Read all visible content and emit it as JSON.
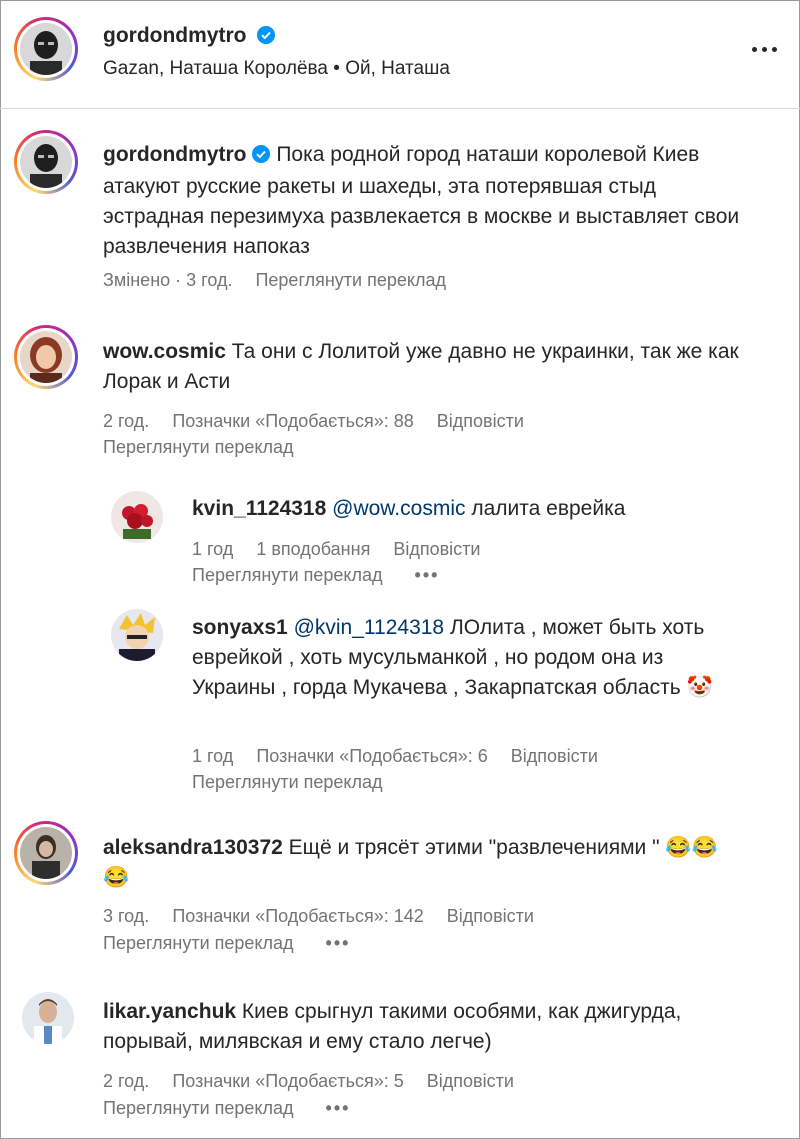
{
  "post": {
    "username": "gordondmytro",
    "audio": "Gazan, Наташа Королёва • Ой, Наташа"
  },
  "caption": {
    "username": "gordondmytro",
    "text": "Пока родной город наташи королевой Киев атакуют русские ракеты и шахеды, эта потерявшая стыд эстрадная перезимуха развлекается в москве и выставляет свои развлечения напоказ",
    "edited": "Змінено · 3 год.",
    "translate": "Переглянути переклад"
  },
  "comments": [
    {
      "username": "wow.cosmic",
      "text": "Та они с Лолитой уже давно не украинки, так же как Лорак и Асти",
      "time": "2 год.",
      "likes": "Позначки «Подобається»: 88",
      "reply": "Відповісти",
      "translate": "Переглянути переклад",
      "replies": [
        {
          "username": "kvin_1124318",
          "mention": "@wow.cosmic",
          "text": "лалита еврейка",
          "time": "1 год",
          "likes": "1 вподобання",
          "reply": "Відповісти",
          "translate": "Переглянути переклад",
          "more": "•••"
        },
        {
          "username": "sonyaxs1",
          "mention": "@kvin_1124318",
          "text": "ЛОлита , может быть хоть еврейкой , хоть мусульманкой , но родом она из Украины , горда Мукачева , Закарпатская область 🤡",
          "time": "1 год",
          "likes": "Позначки «Подобається»: 6",
          "reply": "Відповісти",
          "translate": "Переглянути переклад"
        }
      ]
    },
    {
      "username": "aleksandra130372",
      "text": "Ещё и трясёт этими \"развлечениями \" 😂😂😂",
      "time": "3 год.",
      "likes": "Позначки «Подобається»: 142",
      "reply": "Відповісти",
      "translate": "Переглянути переклад",
      "more": "•••"
    },
    {
      "username": "likar.yanchuk",
      "text": "Киев срыгнул такими особями, как джигурда, порывай, милявская и ему стало легче)",
      "time": "2 год.",
      "likes": "Позначки «Подобається»: 5",
      "reply": "Відповісти",
      "translate": "Переглянути переклад",
      "more": "•••"
    }
  ],
  "colors": {
    "verified": "#0095f6",
    "meta": "#737373",
    "mention": "#00376b",
    "text": "#262626"
  },
  "icons": {
    "verified": "verified-badge-icon",
    "more": "more-options-icon"
  }
}
